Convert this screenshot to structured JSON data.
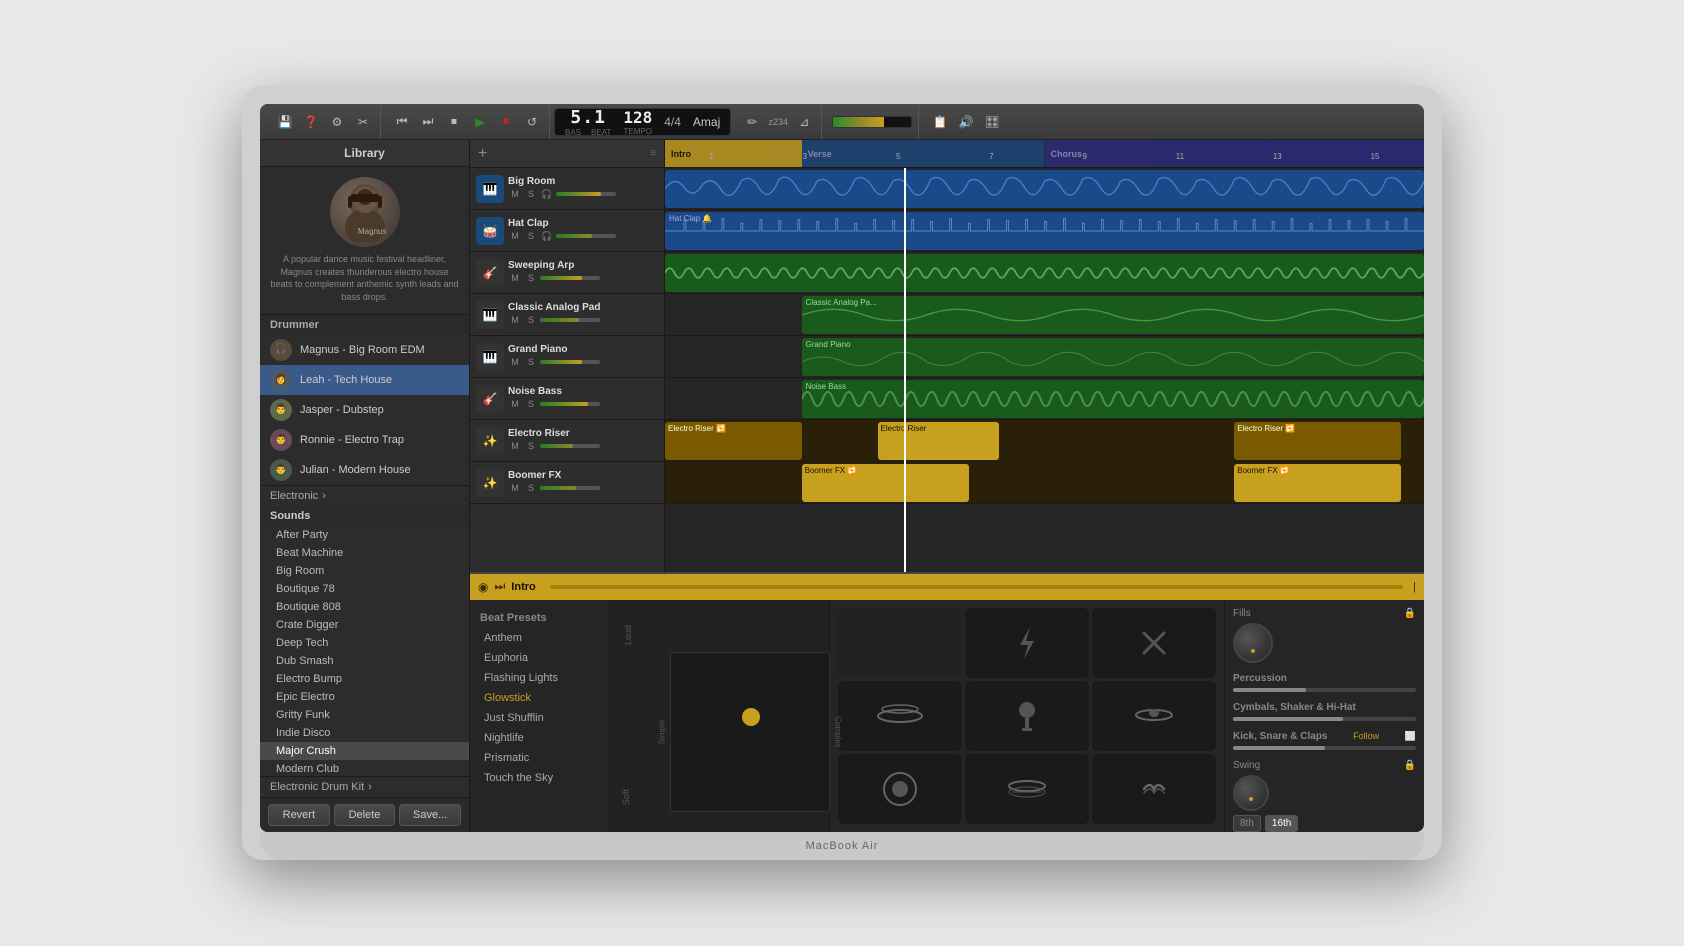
{
  "app": {
    "title": "MacBook Air",
    "toolbar": {
      "transport": {
        "position": "5.1",
        "bpm": "128",
        "time_sig": "4/4",
        "key": "Amaj",
        "label_bass": "BAS",
        "label_beat": "BEAT",
        "label_tempo": "TEMPO"
      },
      "buttons": {
        "rewind": "⏮",
        "fastfwd": "⏭",
        "stop": "⏹",
        "play": "▶",
        "record": "⏺",
        "loop": "↺"
      }
    }
  },
  "library": {
    "title": "Library",
    "section_drummer": "Drummer",
    "artist": {
      "name": "Magnus",
      "bio": "A popular dance music festival headliner, Magnus creates thunderous electro house beats to complement anthemic synth leads and bass drops."
    },
    "drummers": [
      {
        "id": "magnus",
        "name": "Magnus - Big Room EDM",
        "active": false
      },
      {
        "id": "leah",
        "name": "Leah - Tech House",
        "active": true
      },
      {
        "id": "jasper",
        "name": "Jasper - Dubstep",
        "active": false
      },
      {
        "id": "ronnie",
        "name": "Ronnie - Electro Trap",
        "active": false
      },
      {
        "id": "julian",
        "name": "Julian - Modern House",
        "active": false
      }
    ],
    "electronic_label": "Electronic",
    "sounds_label": "Sounds",
    "sounds": [
      "After Party",
      "Beat Machine",
      "Big Room",
      "Boutique 78",
      "Boutique 808",
      "Crate Digger",
      "Deep Tech",
      "Dub Smash",
      "Electro Bump",
      "Epic Electro",
      "Gritty Funk",
      "Indie Disco",
      "Major Crush",
      "Modern Club"
    ],
    "sounds_active": "Major Crush",
    "electronic_drum_kit": "Electronic Drum Kit",
    "footer_buttons": {
      "revert": "Revert",
      "delete": "Delete",
      "save": "Save..."
    }
  },
  "tracks": [
    {
      "id": "big-room",
      "name": "Big Room",
      "icon": "🎹",
      "color": "#1a4a7a",
      "fader_pct": 75
    },
    {
      "id": "hat-clap",
      "name": "Hat Clap",
      "icon": "🥁",
      "color": "#1a4a7a",
      "fader_pct": 60
    },
    {
      "id": "sweeping-arp",
      "name": "Sweeping Arp",
      "icon": "🎸",
      "color": "#1a5a1a",
      "fader_pct": 70
    },
    {
      "id": "classic-analog",
      "name": "Classic Analog Pad",
      "icon": "🎹",
      "color": "#1a5a1a",
      "fader_pct": 65
    },
    {
      "id": "grand-piano",
      "name": "Grand Piano",
      "icon": "🎹",
      "color": "#1a5a1a",
      "fader_pct": 70
    },
    {
      "id": "noise-bass",
      "name": "Noise Bass",
      "icon": "🎸",
      "color": "#1a5a1a",
      "fader_pct": 80
    },
    {
      "id": "electro-riser",
      "name": "Electro Riser",
      "icon": "✨",
      "color": "#7a5a00",
      "fader_pct": 55
    },
    {
      "id": "boomer-fx",
      "name": "Boomer FX",
      "icon": "✨",
      "color": "#7a5a00",
      "fader_pct": 60
    }
  ],
  "beat_editor": {
    "section": "Intro",
    "presets_label": "Beat Presets",
    "presets": [
      {
        "name": "Anthem",
        "active": false
      },
      {
        "name": "Euphoria",
        "active": false
      },
      {
        "name": "Flashing Lights",
        "active": false
      },
      {
        "name": "Glowstick",
        "active": true
      },
      {
        "name": "Just Shufflin",
        "active": false
      },
      {
        "name": "Nightlife",
        "active": false
      },
      {
        "name": "Prismatic",
        "active": false
      },
      {
        "name": "Touch the Sky",
        "active": false
      }
    ],
    "controls": {
      "percussion_label": "Percussion",
      "cymbals_label": "Cymbals, Shaker & Hi-Hat",
      "kick_label": "Kick, Snare & Claps",
      "kick_follow": "Follow",
      "fills_label": "Fills",
      "swing_label": "Swing",
      "note_8th": "8th",
      "note_16th": "16th"
    },
    "y_axis": {
      "loud": "Loud",
      "soft": "Soft",
      "simple": "Simple",
      "complex": "Complex"
    }
  }
}
